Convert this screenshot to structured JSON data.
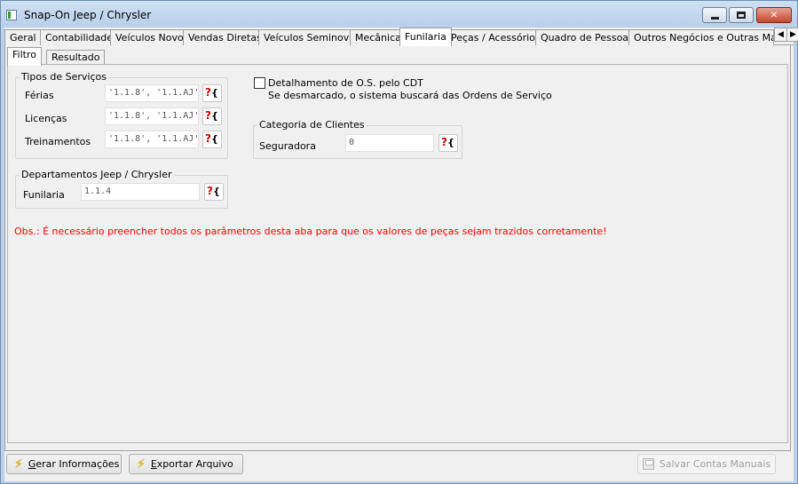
{
  "window": {
    "title": "Snap-On Jeep / Chrysler"
  },
  "tabs": [
    {
      "label": "Geral"
    },
    {
      "label": "Contabilidade"
    },
    {
      "label": "Veículos Novos"
    },
    {
      "label": "Vendas Diretas"
    },
    {
      "label": "Veículos Seminovos"
    },
    {
      "label": "Mecânica"
    },
    {
      "label": "Funilaria",
      "active": true
    },
    {
      "label": "Peças / Acessórios"
    },
    {
      "label": "Quadro de Pessoas"
    },
    {
      "label": "Outros Negócios e Outras Mar"
    }
  ],
  "subtabs": [
    {
      "label": "Filtro",
      "active": true
    },
    {
      "label": "Resultado"
    }
  ],
  "tipos_servicos": {
    "legend": "Tipos de Serviços",
    "rows": [
      {
        "label": "Férias",
        "value": "'1.1.8', '1.1.AJ'"
      },
      {
        "label": "Licenças",
        "value": "'1.1.8', '1.1.AJ'"
      },
      {
        "label": "Treinamentos",
        "value": "'1.1.8', '1.1.AJ'"
      }
    ]
  },
  "departamentos": {
    "legend": "Departamentos Jeep / Chrysler",
    "rows": [
      {
        "label": "Funilaria",
        "value": "1.1.4"
      }
    ]
  },
  "detalhamento": {
    "label": "Detalhamento de O.S. pelo CDT",
    "hint": "Se desmarcado, o sistema buscará das Ordens de Serviço",
    "checked": false
  },
  "categoria_clientes": {
    "legend": "Categoria de Clientes",
    "rows": [
      {
        "label": "Seguradora",
        "value": "0"
      }
    ]
  },
  "lookup_button": {
    "q": "?",
    "brace": "{"
  },
  "obs_text": "Obs.: É necessário preencher todos os parâmetros desta aba para que os valores de peças sejam trazidos corretamente!",
  "buttons": {
    "gerar_first": "G",
    "gerar_rest": "erar Informações",
    "exportar_first": "E",
    "exportar_rest": "xportar Arquivo",
    "salvar": "Salvar Contas Manuais"
  },
  "icons": {
    "gerar": "lightning-icon",
    "exportar": "lightning-icon",
    "salvar": "save-icon"
  }
}
